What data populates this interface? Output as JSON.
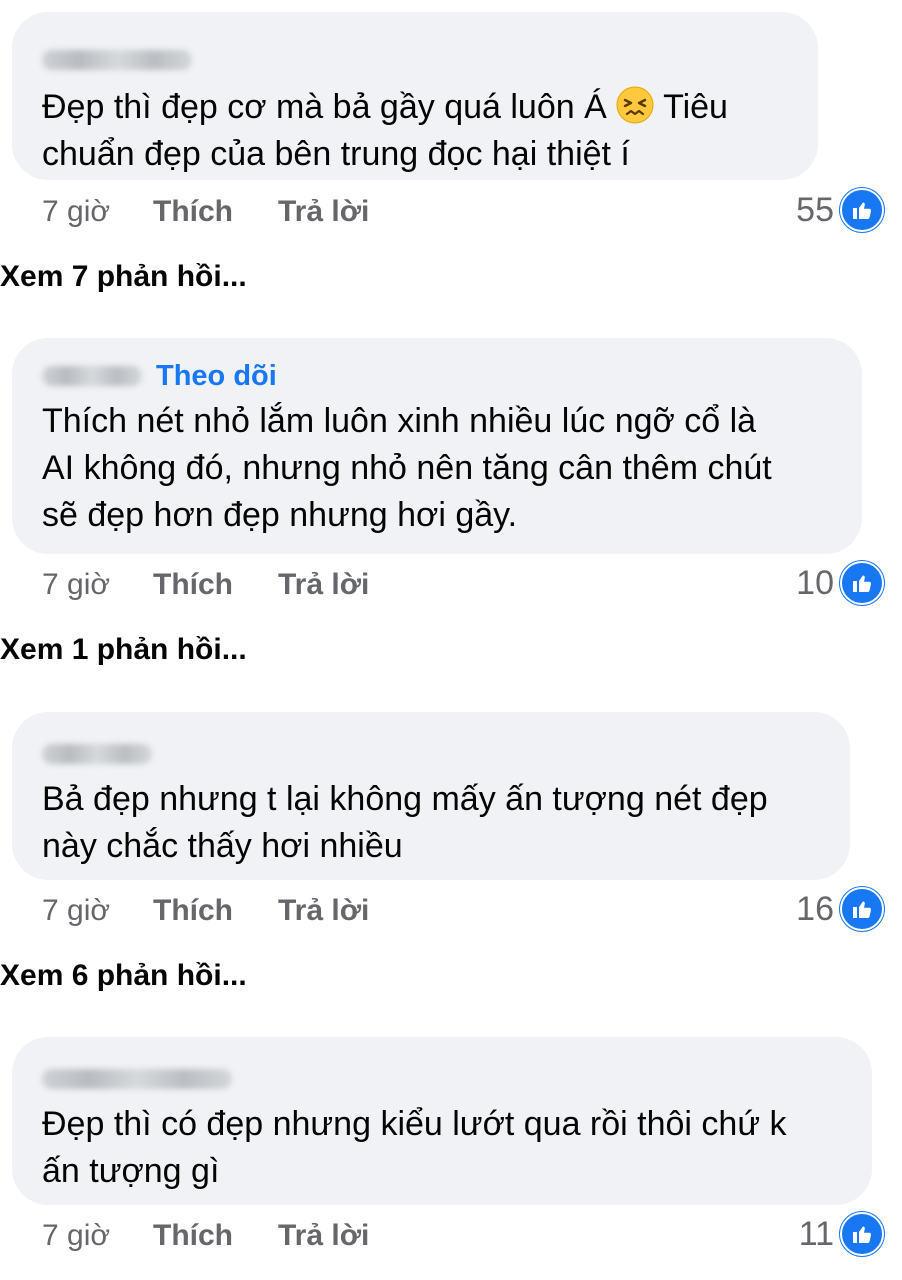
{
  "comments": [
    {
      "follow_label": "",
      "text": "Đẹp thì đẹp cơ mà bả gầy quá luôn Á",
      "text_after_emoji": " Tiêu\nchuẩn đẹp của bên trung đọc hại thiệt í",
      "emoji": "confounded-face-icon",
      "time": "7 giờ",
      "like_label": "Thích",
      "reply_label": "Trả lời",
      "reaction_count": "55",
      "view_replies": "Xem 7 phản hồi..."
    },
    {
      "follow_label": "Theo dõi",
      "text": "Thích nét nhỏ lắm luôn xinh nhiều lúc ngỡ cổ là\nAI không đó, nhưng nhỏ nên tăng cân thêm chút\nsẽ đẹp hơn đẹp nhưng hơi gầy.",
      "time": "7 giờ",
      "like_label": "Thích",
      "reply_label": "Trả lời",
      "reaction_count": "10",
      "view_replies": "Xem 1 phản hồi..."
    },
    {
      "text": "Bả đẹp nhưng t lại không mấy ấn tượng nét đẹp\nnày chắc thấy hơi nhiều",
      "time": "7 giờ",
      "like_label": "Thích",
      "reply_label": "Trả lời",
      "reaction_count": "16",
      "view_replies": "Xem 6 phản hồi..."
    },
    {
      "text": "Đẹp thì có đẹp nhưng kiểu lướt qua rồi thôi chứ k\nấn tượng gì",
      "time": "7 giờ",
      "like_label": "Thích",
      "reply_label": "Trả lời",
      "reaction_count": "11"
    }
  ],
  "colors": {
    "bubble": "#f0f2f5",
    "accent": "#1877f2",
    "secondary_text": "#65676b"
  }
}
